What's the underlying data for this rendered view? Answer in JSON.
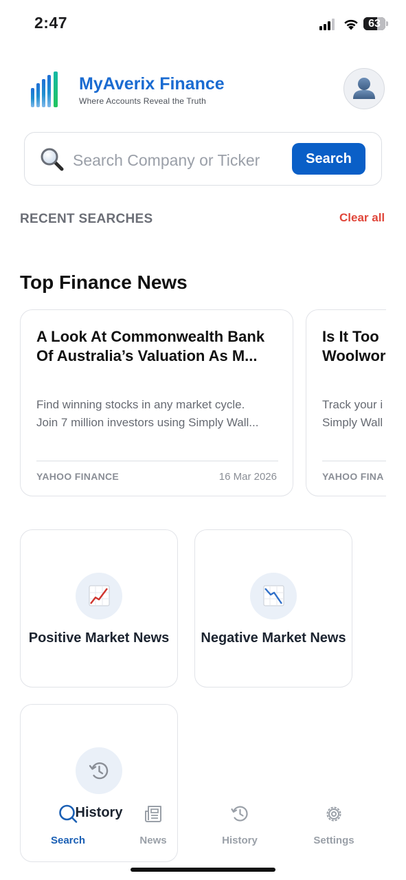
{
  "status_bar": {
    "time": "2:47",
    "battery": "63",
    "battery_fraction": 0.63
  },
  "header": {
    "title": "MyAverix Finance",
    "tagline": "Where Accounts Reveal the Truth",
    "logo_icon": "bar-chart-logo-icon",
    "avatar_icon": "user-silhouette-icon"
  },
  "search": {
    "placeholder": "Search Company or Ticker",
    "button_label": "Search",
    "icon": "magnifier-icon"
  },
  "recent": {
    "label": "RECENT SEARCHES",
    "clear_label": "Clear all"
  },
  "news": {
    "section_title": "Top Finance News",
    "cards": [
      {
        "title_line1": "A Look At Commonwealth Bank",
        "title_line2": "Of Australia’s Valuation As M...",
        "desc_line1": "Find winning stocks in any market cycle.",
        "desc_line2": "Join 7 million investors using Simply Wall...",
        "source": "YAHOO FINANCE",
        "date": "16 Mar 2026"
      },
      {
        "title_line1": "Is It Too",
        "title_line2": "Woolwor",
        "desc_line1": "Track your i",
        "desc_line2": "Simply Wall",
        "source": "YAHOO FINA",
        "date": ""
      }
    ]
  },
  "tiles": [
    {
      "label": "Positive Market News",
      "icon": "chart-increasing-icon"
    },
    {
      "label": "Negative Market News",
      "icon": "chart-decreasing-icon"
    },
    {
      "label": "History",
      "icon": "history-clock-icon"
    }
  ],
  "tabbar": {
    "items": [
      {
        "label": "Search",
        "icon": "search-icon",
        "active": true
      },
      {
        "label": "News",
        "icon": "newspaper-icon",
        "active": false
      },
      {
        "label": "History",
        "icon": "history-icon",
        "active": false
      },
      {
        "label": "Settings",
        "icon": "gear-icon",
        "active": false
      }
    ]
  },
  "colors": {
    "accent": "#1a6bd1",
    "button": "#0a5fc7",
    "danger": "#e0463a",
    "active_tab": "#1a5fb4",
    "inactive_tab": "#9aa0a8"
  }
}
